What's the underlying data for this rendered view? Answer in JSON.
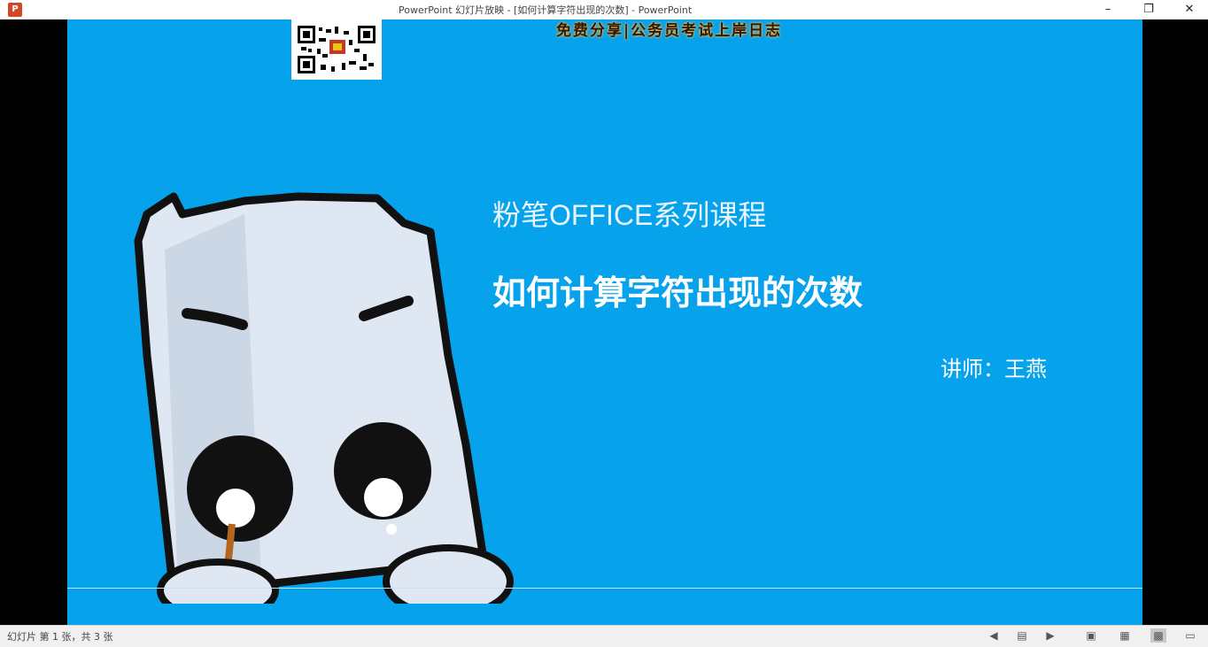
{
  "window": {
    "title": "PowerPoint 幻灯片放映 - [如何计算字符出现的次数] - PowerPoint",
    "app_icon": "powerpoint-icon",
    "buttons": [
      "minimize-icon",
      "restore-icon",
      "close-icon"
    ]
  },
  "slide": {
    "banner": "免费分享|公务员考试上岸日志",
    "series_title": "粉笔OFFICE系列课程",
    "main_title": "如何计算字符出现的次数",
    "lecturer": "讲师：王燕",
    "background_color": "#06a2ec"
  },
  "status": {
    "slide_count": "幻灯片 第 1 张，共 3 张",
    "icons": [
      "previous-icon",
      "notes-icon",
      "next-icon",
      "normal-view-icon",
      "slide-sorter-icon",
      "reading-view-icon",
      "slideshow-icon"
    ]
  }
}
